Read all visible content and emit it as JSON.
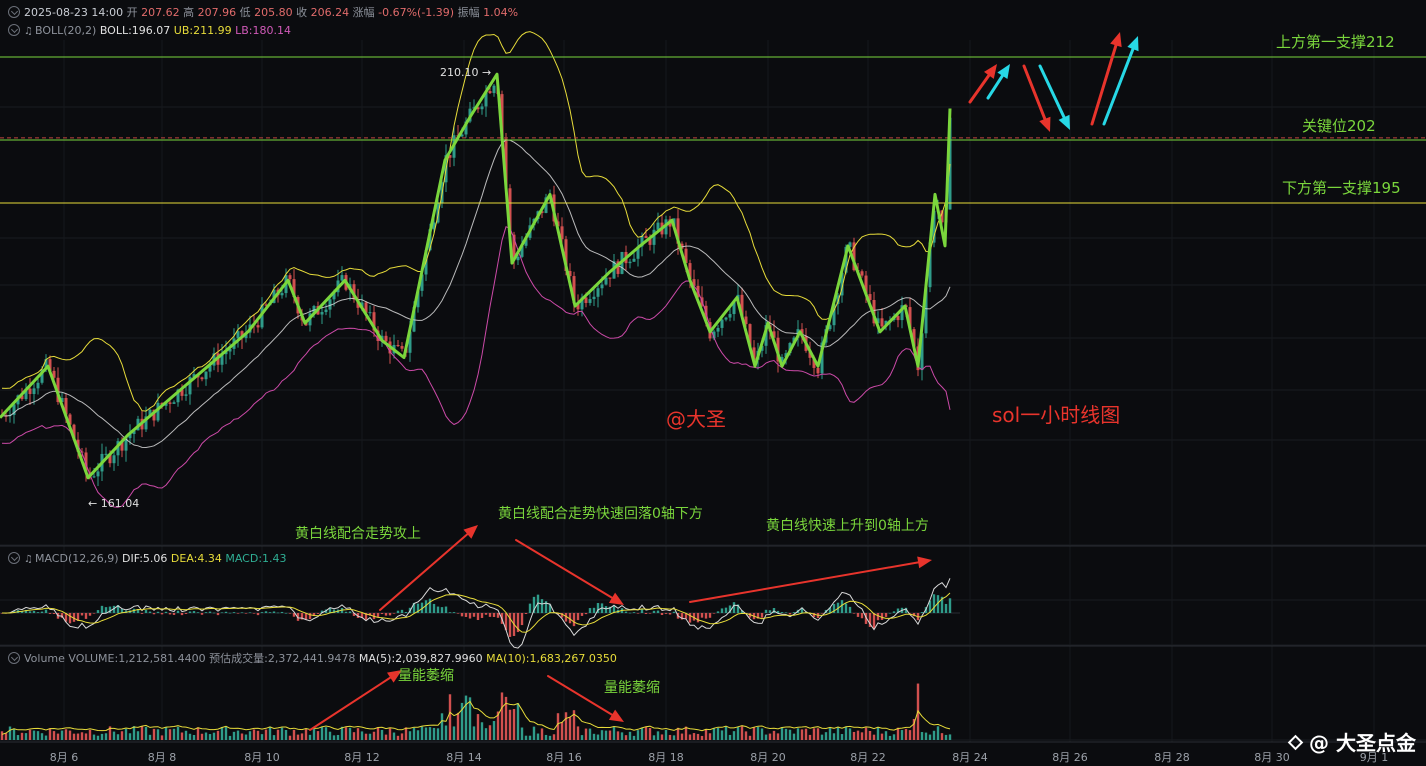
{
  "header": {
    "datetime": "2025-08-23 14:00",
    "open_label": "开",
    "open": "207.62",
    "high_label": "高",
    "high": "207.96",
    "low_label": "低",
    "low": "205.80",
    "close_label": "收",
    "close": "206.24",
    "change_label": "涨幅",
    "change": "-0.67%(-1.39)",
    "amp_label": "振幅",
    "amp": "1.04%"
  },
  "boll": {
    "name": "BOLL(20,2)",
    "boll": "BOLL:196.07",
    "ub": "UB:211.99",
    "lb": "LB:180.14"
  },
  "macd": {
    "name": "MACD(12,26,9)",
    "dif": "DIF:5.06",
    "dea": "DEA:4.34",
    "macd": "MACD:1.43"
  },
  "volume": {
    "name": "Volume",
    "volume": "VOLUME:1,212,581.4400",
    "estimate": "预估成交量:2,372,441.9478",
    "ma5": "MA(5):2,039,827.9960",
    "ma10": "MA(10):1,683,267.0350"
  },
  "levels": {
    "upper": "上方第一支撑212",
    "key": "关键位202",
    "lower": "下方第一支撑195"
  },
  "annotations": {
    "high_marker": "210.10 →",
    "low_marker": "← 161.04",
    "author": "@大圣",
    "title": "sol一小时线图",
    "note1": "黄白线配合走势攻上",
    "note2": "黄白线配合走势快速回落0轴下方",
    "note3": "黄白线快速上升到0轴上方",
    "vol_note1": "量能萎缩",
    "vol_note2": "量能萎缩"
  },
  "watermark": "@ 大圣点金",
  "colors": {
    "bg": "#0b0c0f",
    "green": "#7ad63c",
    "yellow": "#e7dc3a",
    "white": "#d9d9d9",
    "magenta": "#cc4aa8",
    "red": "#e8342c",
    "cyan": "#27d8e6",
    "up": "#2f9c8a",
    "down": "#d2504f"
  },
  "chart_data": {
    "type": "candlestick",
    "symbol_note": "sol一小时线图",
    "x_ticks": [
      "8月 6",
      "8月 8",
      "8月 10",
      "8月 12",
      "8月 14",
      "8月 16",
      "8月 18",
      "8月 20",
      "8月 22",
      "8月 24",
      "8月 26",
      "8月 28",
      "8月 30",
      "9月 1"
    ],
    "price_levels": {
      "upper": 212,
      "key": 202,
      "lower": 195
    },
    "marked_high": 210.1,
    "marked_low": 161.04,
    "last": {
      "open": 207.62,
      "high": 207.96,
      "low": 205.8,
      "close": 206.24,
      "boll": 196.07,
      "ub": 211.99,
      "lb": 180.14
    },
    "macd_last": {
      "dif": 5.06,
      "dea": 4.34,
      "macd": 1.43
    },
    "volume_last": {
      "volume": 1212581.44,
      "ma5": 2039827.996,
      "ma10": 1683267.035
    },
    "wave_path_prices": [
      170,
      176,
      164,
      168,
      174,
      178,
      182,
      188,
      186,
      180,
      186,
      178,
      172,
      176,
      200,
      208,
      210,
      184,
      190,
      178,
      182,
      186,
      190,
      184,
      176,
      178,
      174,
      176,
      172,
      174,
      170,
      176,
      182,
      176,
      172,
      180,
      174,
      188,
      202,
      212
    ]
  }
}
